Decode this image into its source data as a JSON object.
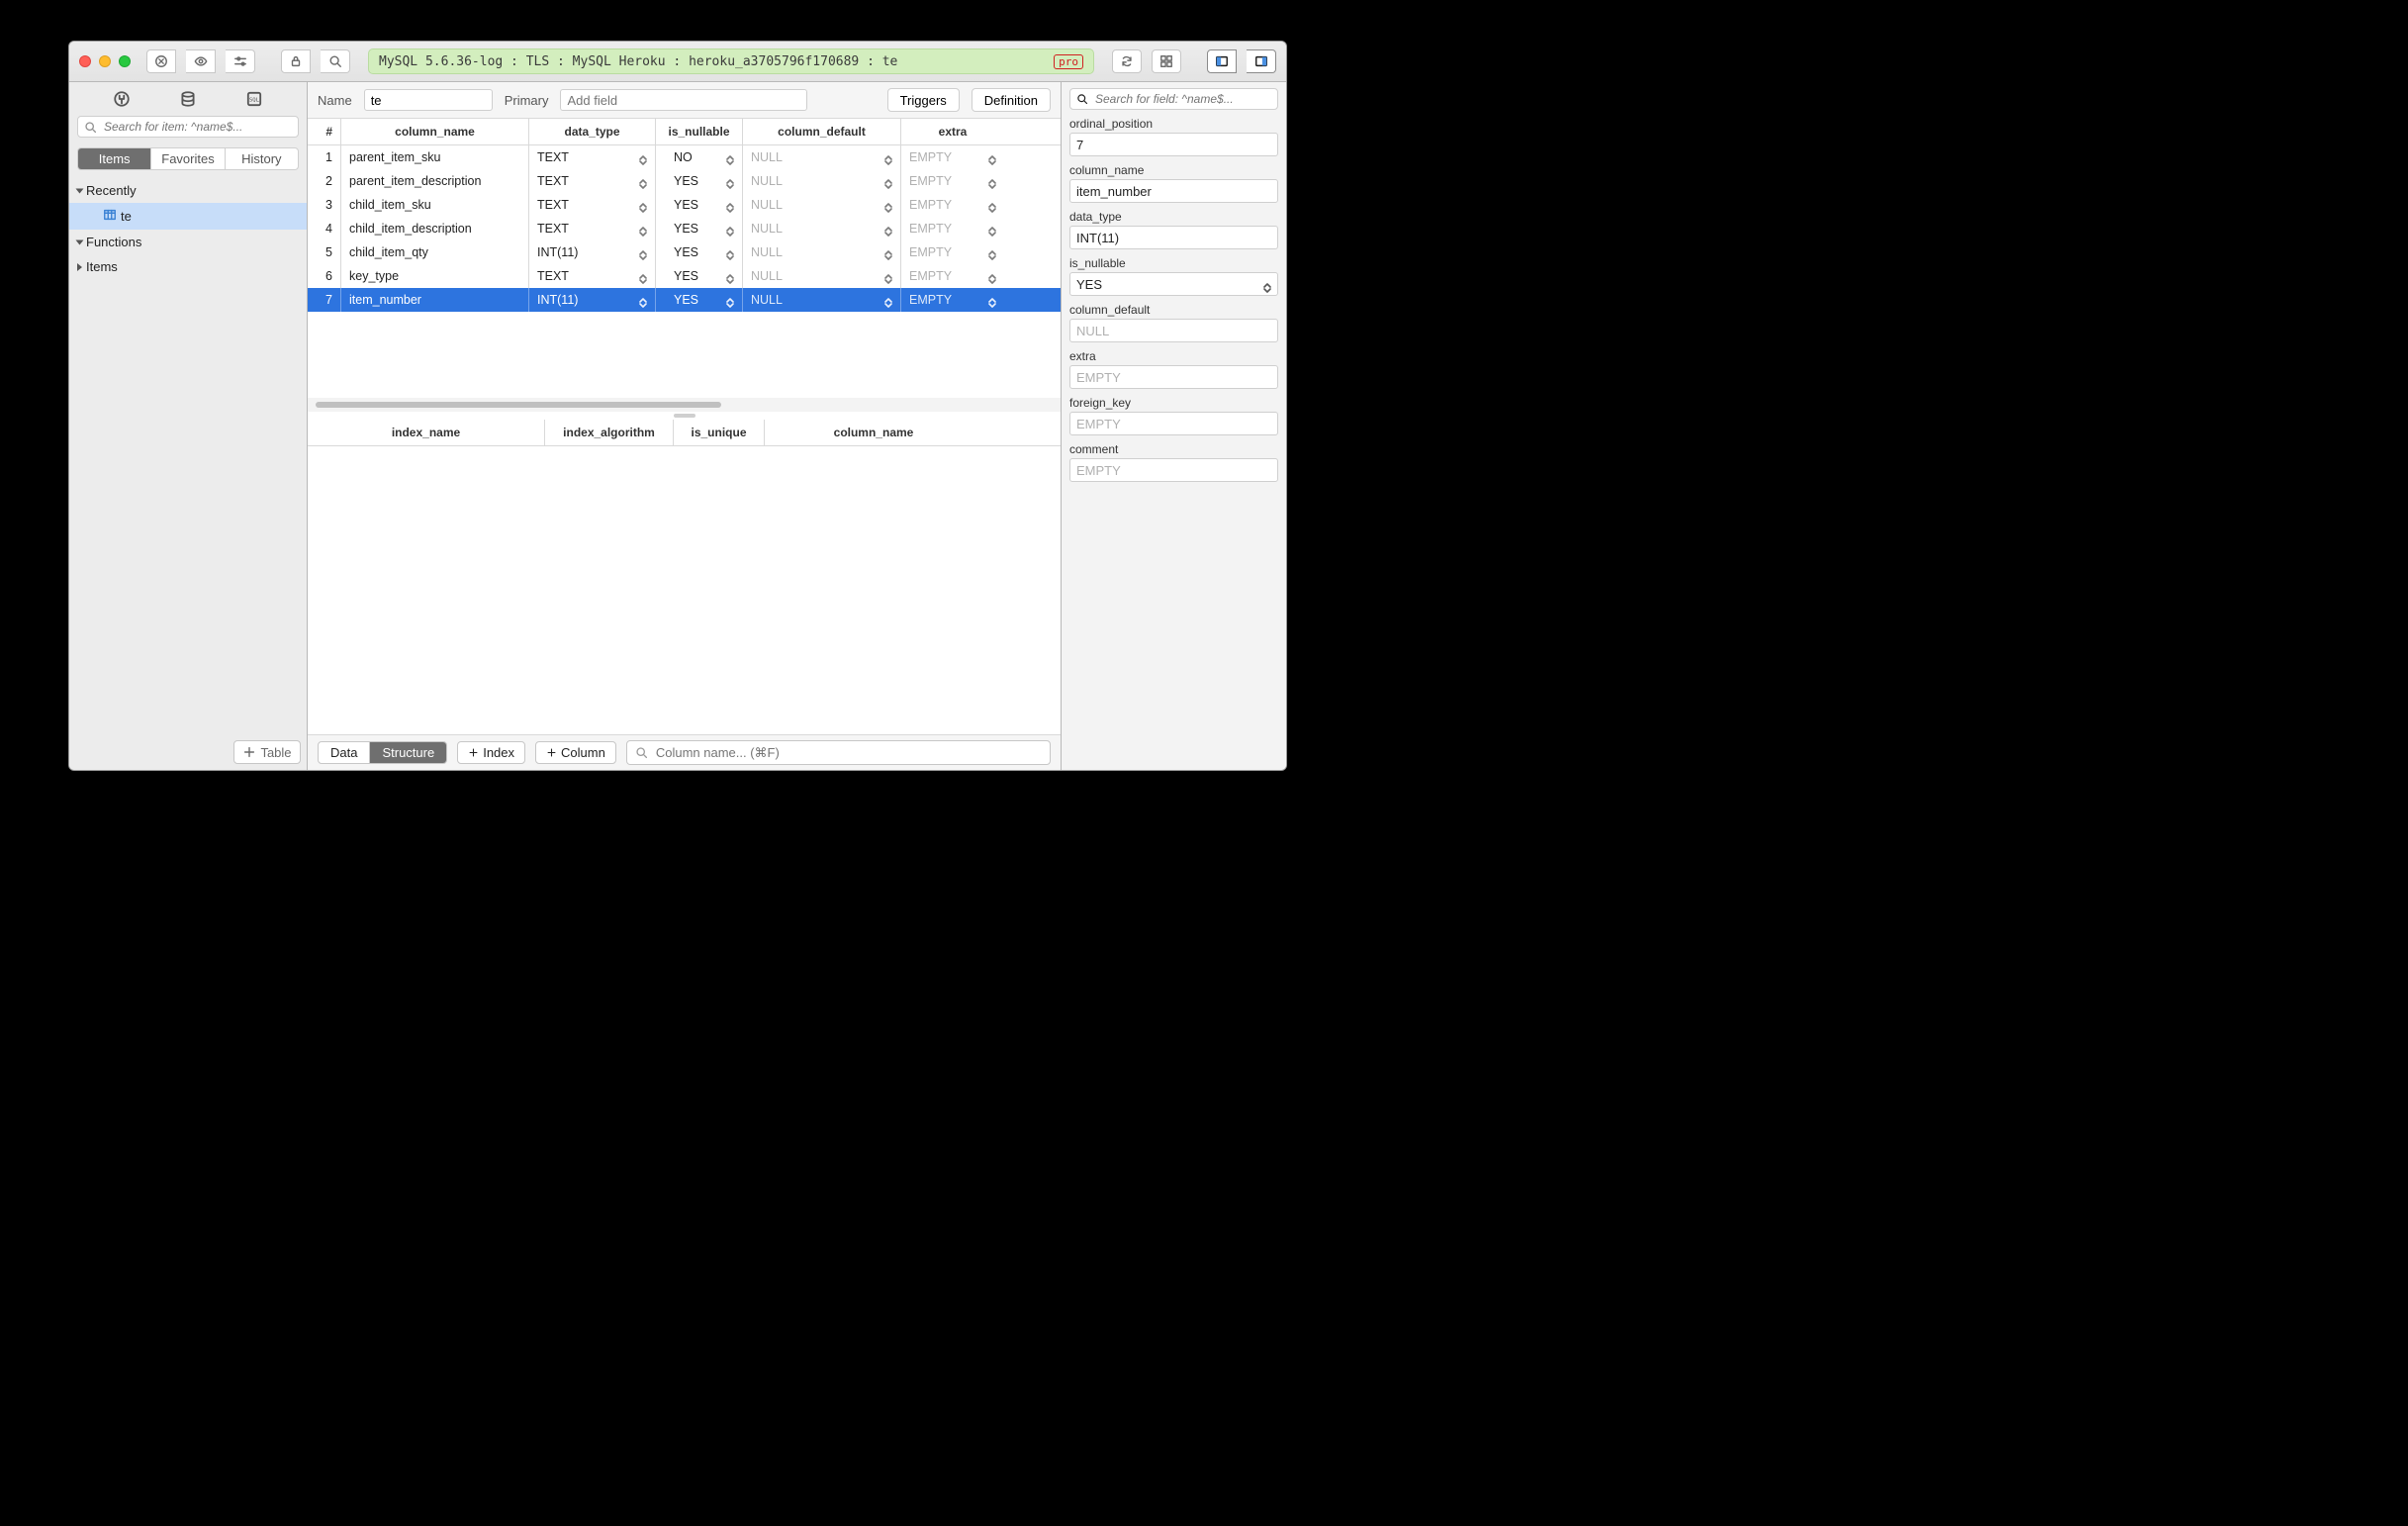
{
  "titlebar": {
    "connection": "MySQL 5.6.36-log : TLS : MySQL Heroku : heroku_a3705796f170689 : te",
    "pro": "pro"
  },
  "sidebar": {
    "search_placeholder": "Search for item: ^name$...",
    "segments": {
      "items": "Items",
      "favorites": "Favorites",
      "history": "History"
    },
    "groups": {
      "recently": "Recently",
      "functions": "Functions",
      "items": "Items"
    },
    "recent_item": "te",
    "add_table": "Table"
  },
  "main": {
    "name_label": "Name",
    "name_value": "te",
    "primary_label": "Primary",
    "addfield_placeholder": "Add field",
    "triggers": "Triggers",
    "definition": "Definition",
    "cols_header": {
      "idx": "#",
      "name": "column_name",
      "dtype": "data_type",
      "nullable": "is_nullable",
      "default": "column_default",
      "extra": "extra"
    },
    "columns": [
      {
        "n": "1",
        "name": "parent_item_sku",
        "dtype": "TEXT",
        "nullable": "NO",
        "default": "NULL",
        "extra": "EMPTY"
      },
      {
        "n": "2",
        "name": "parent_item_description",
        "dtype": "TEXT",
        "nullable": "YES",
        "default": "NULL",
        "extra": "EMPTY"
      },
      {
        "n": "3",
        "name": "child_item_sku",
        "dtype": "TEXT",
        "nullable": "YES",
        "default": "NULL",
        "extra": "EMPTY"
      },
      {
        "n": "4",
        "name": "child_item_description",
        "dtype": "TEXT",
        "nullable": "YES",
        "default": "NULL",
        "extra": "EMPTY"
      },
      {
        "n": "5",
        "name": "child_item_qty",
        "dtype": "INT(11)",
        "nullable": "YES",
        "default": "NULL",
        "extra": "EMPTY"
      },
      {
        "n": "6",
        "name": "key_type",
        "dtype": "TEXT",
        "nullable": "YES",
        "default": "NULL",
        "extra": "EMPTY"
      },
      {
        "n": "7",
        "name": "item_number",
        "dtype": "INT(11)",
        "nullable": "YES",
        "default": "NULL",
        "extra": "EMPTY",
        "selected": true
      }
    ],
    "idx_header": {
      "name": "index_name",
      "algo": "index_algorithm",
      "unique": "is_unique",
      "col": "column_name"
    },
    "bottom": {
      "data": "Data",
      "structure": "Structure",
      "index": "Index",
      "column": "Column",
      "search_placeholder": "Column name... (⌘F)"
    }
  },
  "inspector": {
    "search_placeholder": "Search for field: ^name$...",
    "fields": {
      "ordinal_position": {
        "label": "ordinal_position",
        "value": "7"
      },
      "column_name": {
        "label": "column_name",
        "value": "item_number"
      },
      "data_type": {
        "label": "data_type",
        "value": "INT(11)"
      },
      "is_nullable": {
        "label": "is_nullable",
        "value": "YES",
        "dropdown": true
      },
      "column_default": {
        "label": "column_default",
        "placeholder": "NULL"
      },
      "extra": {
        "label": "extra",
        "placeholder": "EMPTY"
      },
      "foreign_key": {
        "label": "foreign_key",
        "placeholder": "EMPTY"
      },
      "comment": {
        "label": "comment",
        "placeholder": "EMPTY"
      }
    }
  }
}
